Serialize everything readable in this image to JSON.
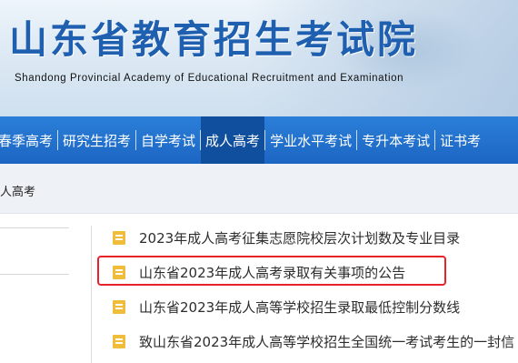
{
  "header": {
    "title": "山东省教育招生考试院",
    "subtitle": "Shandong Provincial Academy of Educational Recruitment and Examination"
  },
  "nav": {
    "items": [
      {
        "label": "春季高考",
        "active": false
      },
      {
        "label": "研究生招考",
        "active": false
      },
      {
        "label": "自学考试",
        "active": false
      },
      {
        "label": "成人高考",
        "active": true
      },
      {
        "label": "学业水平考试",
        "active": false
      },
      {
        "label": "专升本考试",
        "active": false
      },
      {
        "label": "证书考",
        "active": false
      }
    ]
  },
  "breadcrumb": {
    "current": "人高考"
  },
  "news": {
    "items": [
      {
        "title": "2023年成人高考征集志愿院校层次计划数及专业目录",
        "highlighted": false
      },
      {
        "title": "山东省2023年成人高考录取有关事项的公告",
        "highlighted": true
      },
      {
        "title": "山东省2023年成人高等学校招生录取最低控制分数线",
        "highlighted": false
      },
      {
        "title": "致山东省2023年成人高等学校招生全国统一考试考生的一封信",
        "highlighted": false
      }
    ]
  },
  "colors": {
    "nav_bg": "#1c66c3",
    "nav_active": "#0f4f9e",
    "title": "#1f5fb0",
    "icon": "#f0bd3a",
    "highlight": "#e8222b"
  },
  "icons": {
    "news_item": "document-icon"
  }
}
